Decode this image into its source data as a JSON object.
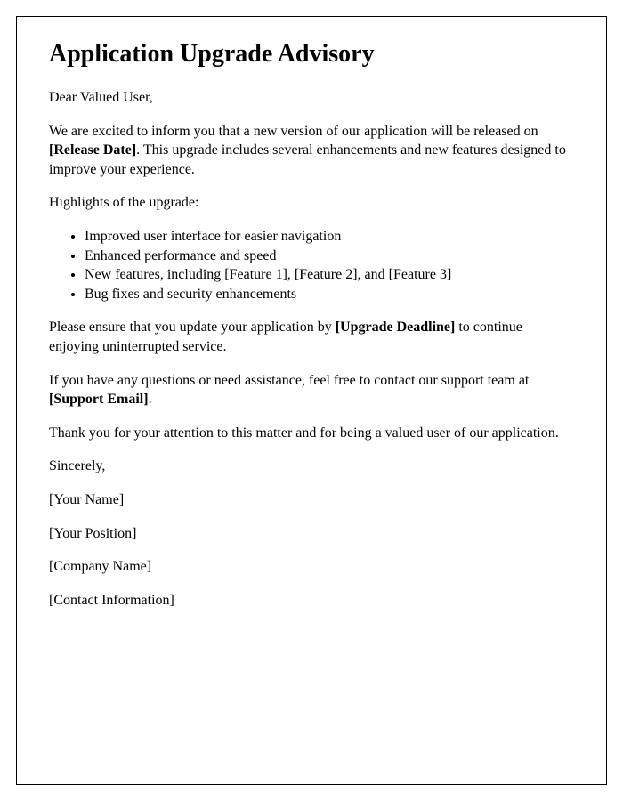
{
  "title": "Application Upgrade Advisory",
  "salutation": "Dear Valued User,",
  "intro_part1": "We are excited to inform you that a new version of our application will be released on ",
  "release_date": "[Release Date]",
  "intro_part2": ". This upgrade includes several enhancements and new features designed to improve your experience.",
  "highlights_heading": "Highlights of the upgrade:",
  "highlights": [
    "Improved user interface for easier navigation",
    "Enhanced performance and speed",
    "New features, including [Feature 1], [Feature 2], and [Feature 3]",
    "Bug fixes and security enhancements"
  ],
  "deadline_part1": "Please ensure that you update your application by ",
  "deadline": "[Upgrade Deadline]",
  "deadline_part2": " to continue enjoying uninterrupted service.",
  "support_part1": "If you have any questions or need assistance, feel free to contact our support team at ",
  "support_email": "[Support Email]",
  "support_part2": ".",
  "thanks": "Thank you for your attention to this matter and for being a valued user of our application.",
  "closing": "Sincerely,",
  "signature": {
    "name": "[Your Name]",
    "position": "[Your Position]",
    "company": "[Company Name]",
    "contact": "[Contact Information]"
  }
}
